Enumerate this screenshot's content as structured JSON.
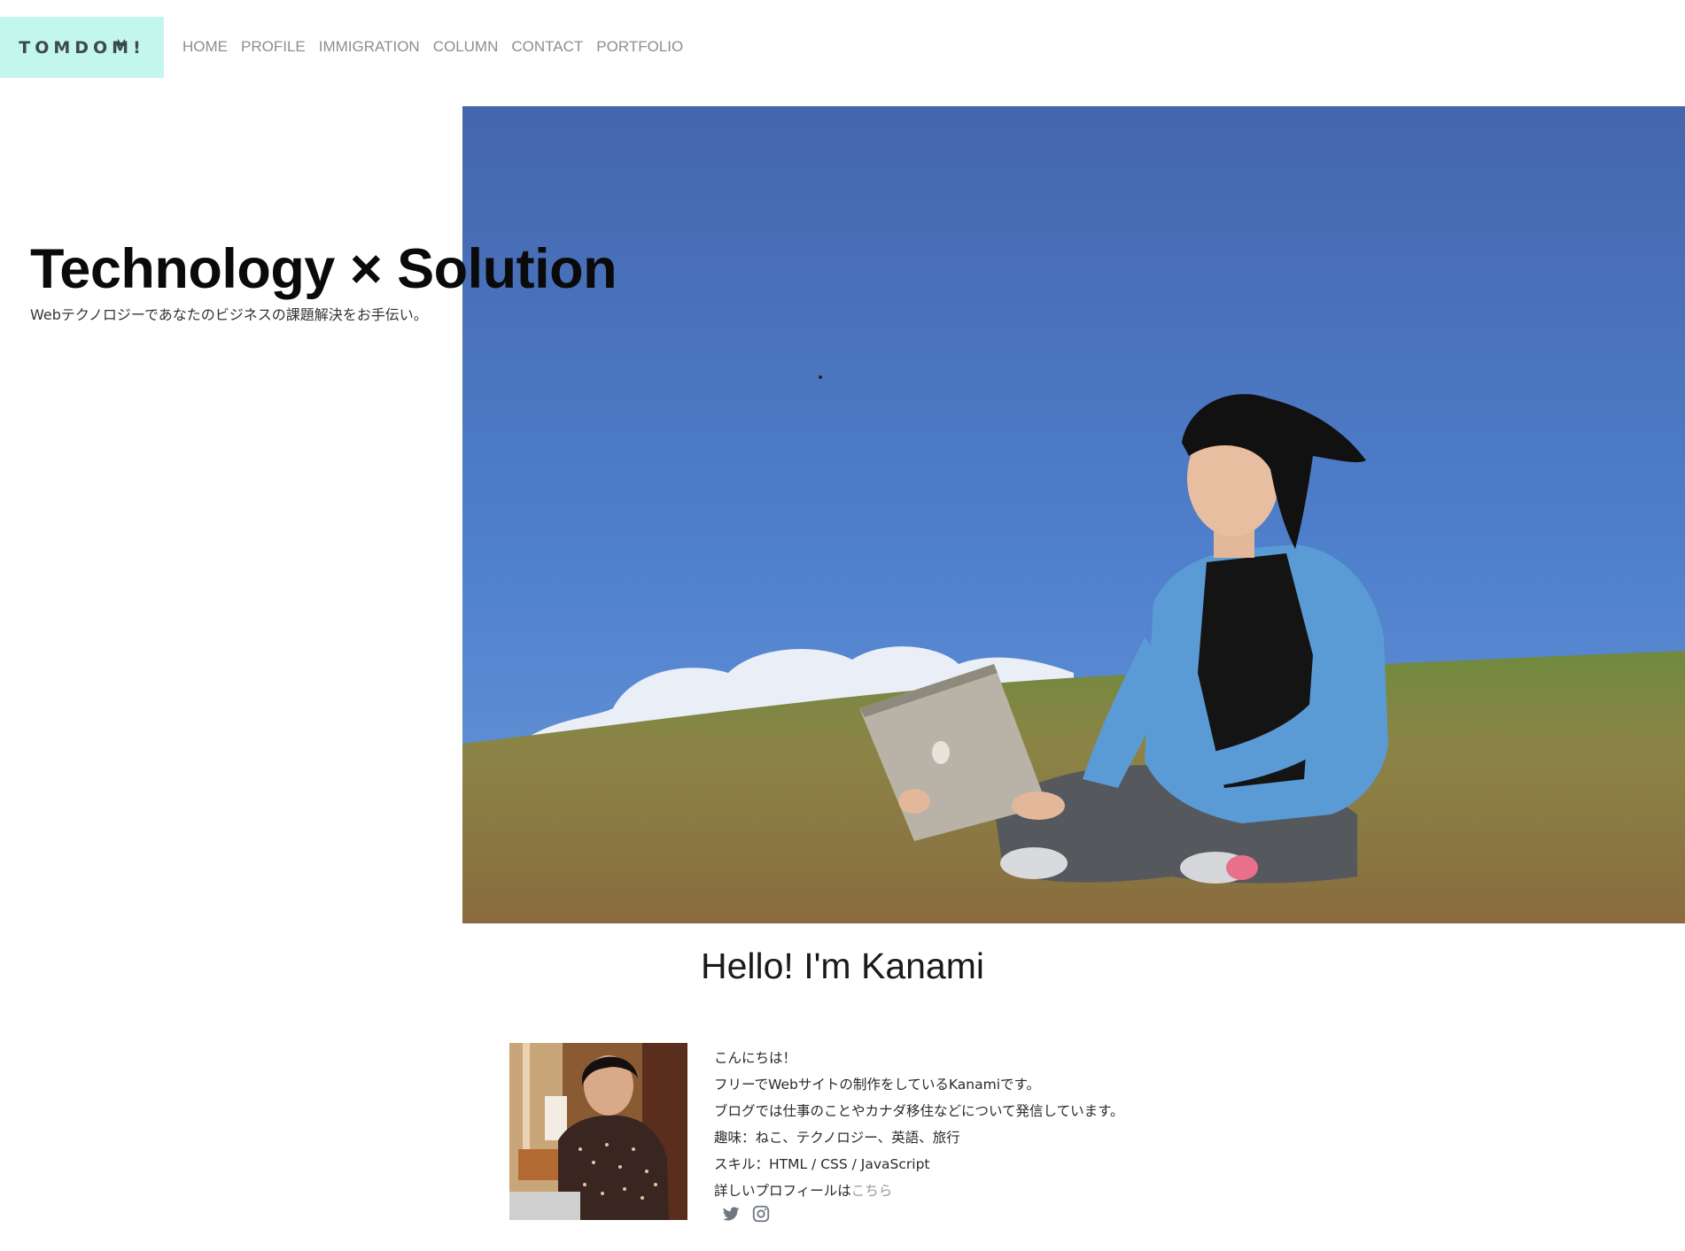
{
  "header": {
    "logo_text": "TOMDOM!",
    "nav": [
      "HOME",
      "PROFILE",
      "IMMIGRATION",
      "COLUMN",
      "CONTACT",
      "PORTFOLIO"
    ]
  },
  "hero": {
    "title": "Technology × Solution",
    "subtitle": "Webテクノロジーであなたのビジネスの課題解決をお手伝い。"
  },
  "intro": {
    "heading": "Hello! I'm Kanami",
    "bio": [
      "こんにちは！",
      "フリーでWebサイトの制作をしているKanamiです。",
      "ブログでは仕事のことやカナダ移住などについて発信しています。",
      "趣味：ねこ、テクノロジー、英語、旅行",
      "スキル：HTML / CSS / JavaScript"
    ],
    "profile_prefix": "詳しいプロフィールは",
    "profile_link": "こちら"
  },
  "social": [
    "twitter-icon",
    "instagram-icon"
  ],
  "colors": {
    "logo_bg": "#c3f7ee",
    "nav_text": "#8a8f8f",
    "sky": "#4a76c4",
    "grass": "#8a7a44",
    "link": "#9a9a9a"
  }
}
